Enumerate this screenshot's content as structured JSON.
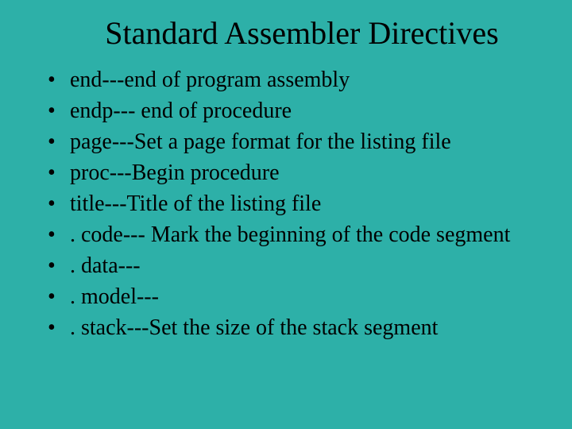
{
  "title": "Standard Assembler Directives",
  "items": [
    " end---end of program assembly",
    "endp--- end of procedure",
    "page---Set a page format for the listing file",
    "proc---Begin procedure",
    "title---Title of the listing file",
    ". code--- Mark the beginning of the code segment",
    ". data---",
    ". model---",
    ". stack---Set the size of the stack segment"
  ]
}
